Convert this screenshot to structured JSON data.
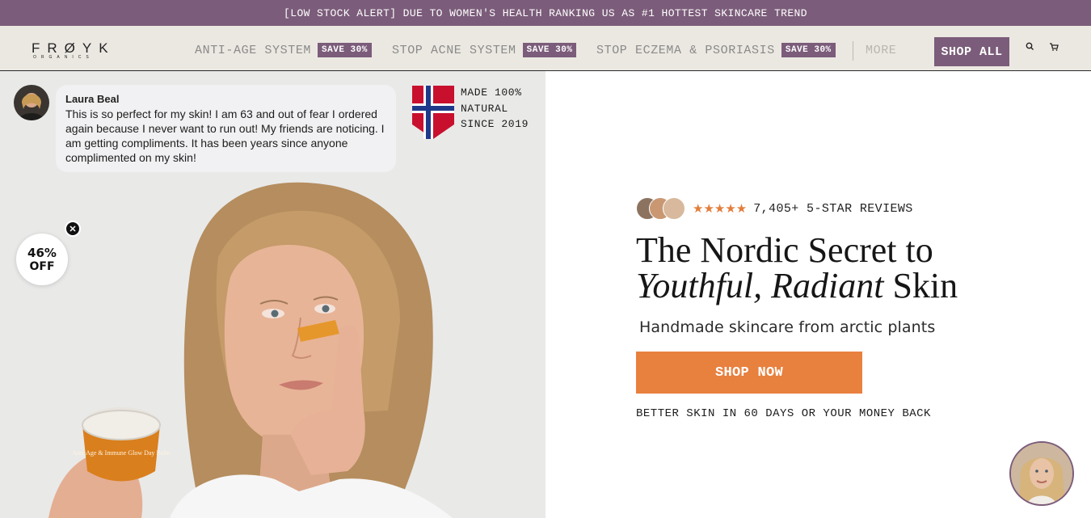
{
  "announcement": "[LOW STOCK ALERT] DUE TO WOMEN'S HEALTH RANKING US AS #1 HOTTEST SKINCARE TREND",
  "logo": {
    "word": "FRØYK",
    "sub": "ORGANICS"
  },
  "nav": {
    "items": [
      {
        "label": "ANTI-AGE SYSTEM",
        "badge": "SAVE 30%"
      },
      {
        "label": "STOP ACNE SYSTEM",
        "badge": "SAVE 30%"
      },
      {
        "label": "STOP ECZEMA & PSORIASIS",
        "badge": "SAVE 30%"
      }
    ],
    "more": "MORE",
    "shop_all": "SHOP ALL",
    "icons": [
      "search-icon",
      "cart-icon"
    ]
  },
  "review": {
    "name": "Laura Beal",
    "text": "This is so perfect for my skin! I am 63 and out of fear I ordered again because I never want to run out! My friends are noticing. I am getting compliments. It has been years since anyone complimented on my skin!"
  },
  "origin": {
    "line1": "MADE 100%",
    "line2": "NATURAL",
    "line3": "SINCE 2019"
  },
  "discount": {
    "pct": "46%",
    "off": "OFF"
  },
  "product_label": "Anti-Age & Immune Glow Day Balm",
  "hero": {
    "stars": "★★★★★",
    "rating_stars": 5,
    "reviews": "7,405+ 5-STAR REVIEWS",
    "headline_line1": "The Nordic Secret to",
    "headline_italic": "Youthful, Radiant",
    "headline_end": " Skin",
    "subhead": "Handmade skincare from arctic plants",
    "cta": "SHOP NOW",
    "guarantee": "BETTER SKIN IN 60 DAYS OR YOUR MONEY BACK"
  },
  "colors": {
    "brand_purple": "#7b5c7a",
    "cta_orange": "#e8803e",
    "nav_bg": "#ebe8e1",
    "star": "#e27d3a"
  }
}
